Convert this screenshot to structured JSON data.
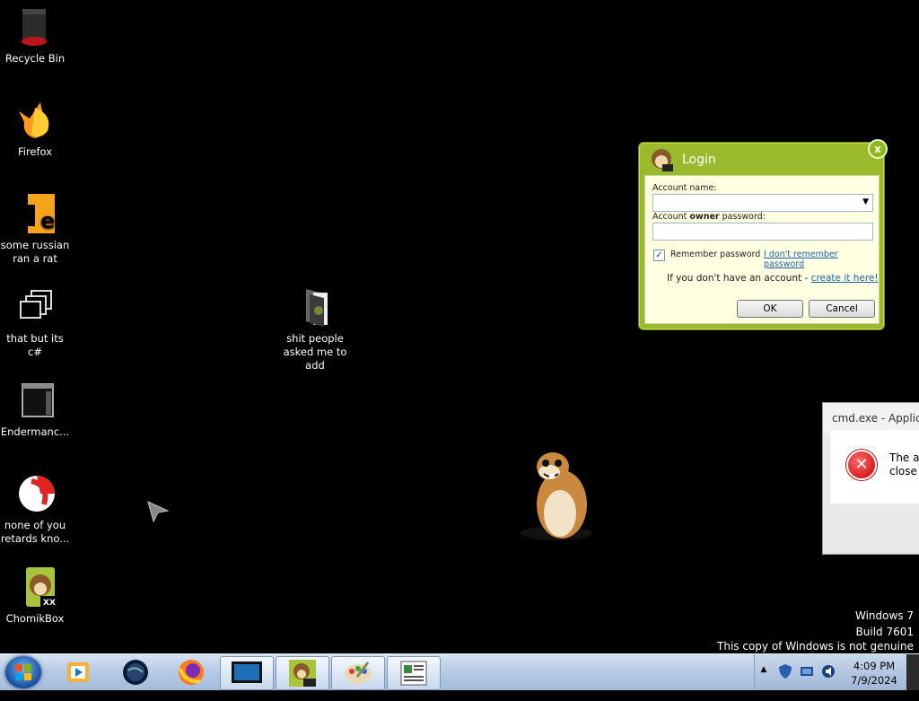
{
  "desktop_icons": [
    {
      "label": "Recycle Bin",
      "icon": "recycle-bin-icon"
    },
    {
      "label": "Firefox",
      "icon": "firefox-icon"
    },
    {
      "label": "some russian ran a rat",
      "icon": "orange-app-icon"
    },
    {
      "label": "that but its c#",
      "icon": "window-stack-icon"
    },
    {
      "label": "Endermanc...",
      "icon": "terminal-icon"
    },
    {
      "label": "none of you retards kno...",
      "icon": "red-white-app-icon"
    },
    {
      "label": "ChomikBox",
      "icon": "chomikbox-icon"
    },
    {
      "label": "shit people asked me to add",
      "icon": "folder-icon"
    }
  ],
  "login": {
    "title": "Login",
    "account_name_label": "Account name:",
    "account_name_value": "",
    "password_label_pre": "Account ",
    "password_label_bold": "owner",
    "password_label_post": " password:",
    "password_value": "",
    "remember_label": "Remember password",
    "remember_checked": true,
    "forgot_link": "I don't remember password",
    "no_account_text": "If you don't have an account - ",
    "create_link": "create it here!",
    "ok_label": "OK",
    "cancel_label": "Cancel",
    "close_label": "x"
  },
  "error_dialog": {
    "title": "cmd.exe - Applicat",
    "message_line1": "The ap",
    "message_line2": "close t"
  },
  "watermark": {
    "line1": "Windows 7",
    "line2": "Build 7601",
    "line3": "This copy of Windows is not genuine"
  },
  "taskbar": {
    "items": [
      "windows-media-player-icon",
      "globe-icon",
      "firefox-icon",
      "monitor-window-icon",
      "chomikbox-icon",
      "paint-icon",
      "document-icon"
    ],
    "time": "4:09 PM",
    "date": "7/9/2024"
  },
  "colors": {
    "login_green": "#9bb92c",
    "login_body": "#ffffe1",
    "link_blue": "#2060b0",
    "error_red": "#c80000"
  }
}
